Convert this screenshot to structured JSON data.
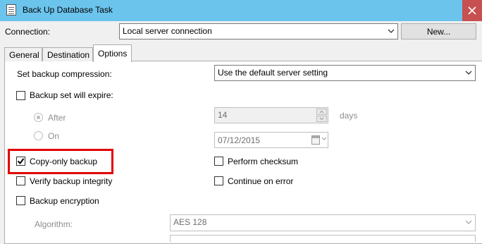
{
  "window": {
    "title": "Back Up Database Task"
  },
  "connection": {
    "label": "Connection:",
    "value": "Local server connection",
    "new_button": "New..."
  },
  "tabs": [
    {
      "label": "General",
      "active": false
    },
    {
      "label": "Destination",
      "active": false
    },
    {
      "label": "Options",
      "active": true
    }
  ],
  "options": {
    "compression": {
      "label": "Set backup compression:",
      "value": "Use the default server setting"
    },
    "expire": {
      "label": "Backup set will expire:",
      "checked": false
    },
    "after": {
      "label": "After",
      "selected": true,
      "value": "14",
      "unit": "days"
    },
    "on": {
      "label": "On",
      "selected": false,
      "date": "07/12/2015"
    },
    "copy_only": {
      "label": "Copy-only backup",
      "checked": true,
      "highlighted": true
    },
    "perform_checksum": {
      "label": "Perform checksum",
      "checked": false
    },
    "verify_integrity": {
      "label": "Verify backup integrity",
      "checked": false
    },
    "continue_on_error": {
      "label": "Continue on error",
      "checked": false
    },
    "encryption": {
      "label": "Backup encryption",
      "checked": false
    },
    "algorithm": {
      "label": "Algorithm:",
      "value": "AES 128"
    }
  },
  "colors": {
    "titlebar": "#6bc4ec",
    "close": "#c75050",
    "highlight": "#e00000"
  }
}
